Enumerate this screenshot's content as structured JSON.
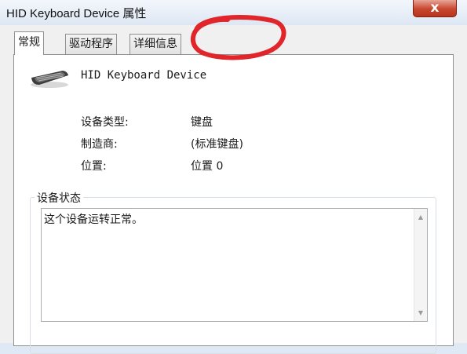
{
  "window": {
    "title": "HID Keyboard Device 属性",
    "close_label": "x"
  },
  "tabs": [
    {
      "label": "常规",
      "active": true
    },
    {
      "label": "驱动程序",
      "active": false
    },
    {
      "label": "详细信息",
      "active": false
    }
  ],
  "device": {
    "name": "HID Keyboard Device",
    "icon": "keyboard-icon"
  },
  "properties": [
    {
      "label": "设备类型:",
      "value": "键盘"
    },
    {
      "label": "制造商:",
      "value": "(标准键盘)"
    },
    {
      "label": "位置:",
      "value": "位置 0"
    }
  ],
  "device_status": {
    "legend": "设备状态",
    "text": "这个设备运转正常。"
  },
  "annotation": {
    "shape": "hand-drawn-circle",
    "color": "#e0262a"
  }
}
